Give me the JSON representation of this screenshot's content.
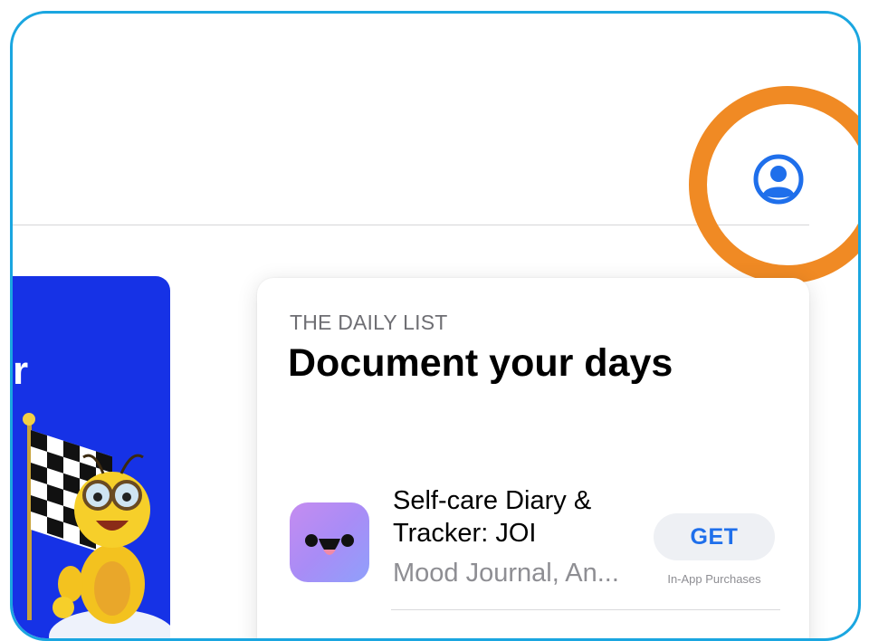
{
  "header": {
    "account_icon": "person-circle-icon",
    "accent_color": "#1f6feb",
    "highlight_color": "#f08a24"
  },
  "promo_card": {
    "visible_letter": "r",
    "background_color": "#1632e6"
  },
  "daily_list": {
    "kicker": "THE DAILY LIST",
    "title": "Document your days",
    "app": {
      "name": "Self-care Diary & Tracker: JOI",
      "subtitle": "Mood Journal, An...",
      "get_label": "GET",
      "iap_note": "In-App Purchases"
    }
  }
}
